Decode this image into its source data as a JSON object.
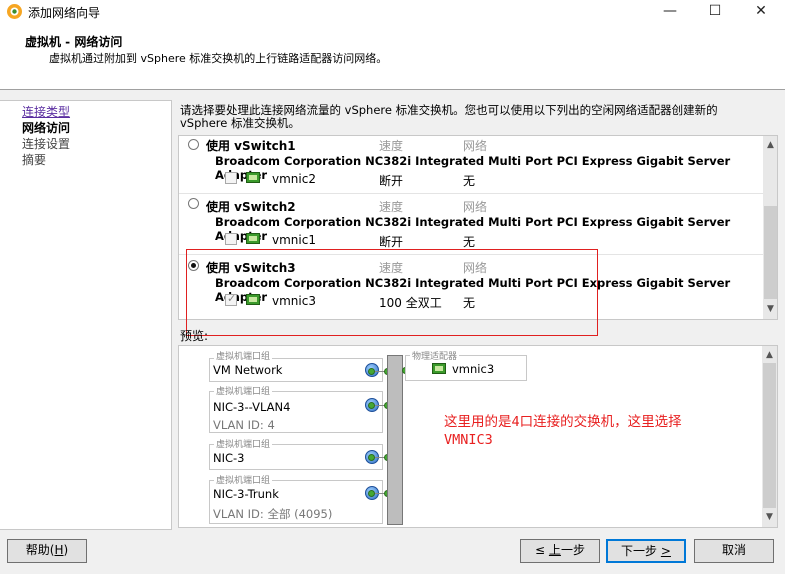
{
  "window": {
    "title": "添加网络向导",
    "minimize": "—",
    "maximize": "☐",
    "close": "✕"
  },
  "header": {
    "title": "虚拟机 - 网络访问",
    "subtitle": "虚拟机通过附加到 vSphere 标准交换机的上行链路适配器访问网络。"
  },
  "nav": {
    "items": [
      "连接类型",
      "网络访问",
      "连接设置",
      "摘要"
    ]
  },
  "instruction": "请选择要处理此连接网络流量的 vSphere 标准交换机。您也可以使用以下列出的空闲网络适配器创建新的 vSphere 标准交换机。",
  "switches": [
    {
      "label": "使用 vSwitch1",
      "selected": false,
      "speed_header": "速度",
      "network_header": "网络",
      "adapter": "Broadcom Corporation NC382i Integrated Multi Port PCI Express Gigabit Server Adapter",
      "nic": "vmnic2",
      "speed": "断开",
      "network": "无",
      "checked": false
    },
    {
      "label": "使用 vSwitch2",
      "selected": false,
      "speed_header": "速度",
      "network_header": "网络",
      "adapter": "Broadcom Corporation NC382i Integrated Multi Port PCI Express Gigabit Server Adapter",
      "nic": "vmnic1",
      "speed": "断开",
      "network": "无",
      "checked": false
    },
    {
      "label": "使用 vSwitch3",
      "selected": true,
      "speed_header": "速度",
      "network_header": "网络",
      "adapter": "Broadcom Corporation NC382i Integrated Multi Port PCI Express Gigabit Server Adapter",
      "nic": "vmnic3",
      "speed": "100 全双工",
      "network": "无",
      "checked": true
    }
  ],
  "preview": {
    "label": "预览:",
    "adapter_legend": "物理适配器",
    "adapter_nic": "vmnic3",
    "port_groups": [
      {
        "legend": "虚拟机端口组",
        "name": "VM Network",
        "vlan": ""
      },
      {
        "legend": "虚拟机端口组",
        "name": "NIC-3--VLAN4",
        "vlan": "VLAN ID: 4"
      },
      {
        "legend": "虚拟机端口组",
        "name": "NIC-3",
        "vlan": ""
      },
      {
        "legend": "虚拟机端口组",
        "name": "NIC-3-Trunk",
        "vlan": "VLAN ID: 全部 (4095)"
      }
    ]
  },
  "annotation": {
    "line1": "这里用的是4口连接的交换机，这里选择",
    "line2": "VMNIC3"
  },
  "buttons": {
    "help": "帮助(",
    "help_key": "H",
    "help_end": ")",
    "back_key": "上",
    "back": "一步",
    "next": "下一步 ",
    "next_key": ">",
    "cancel": "取消"
  }
}
